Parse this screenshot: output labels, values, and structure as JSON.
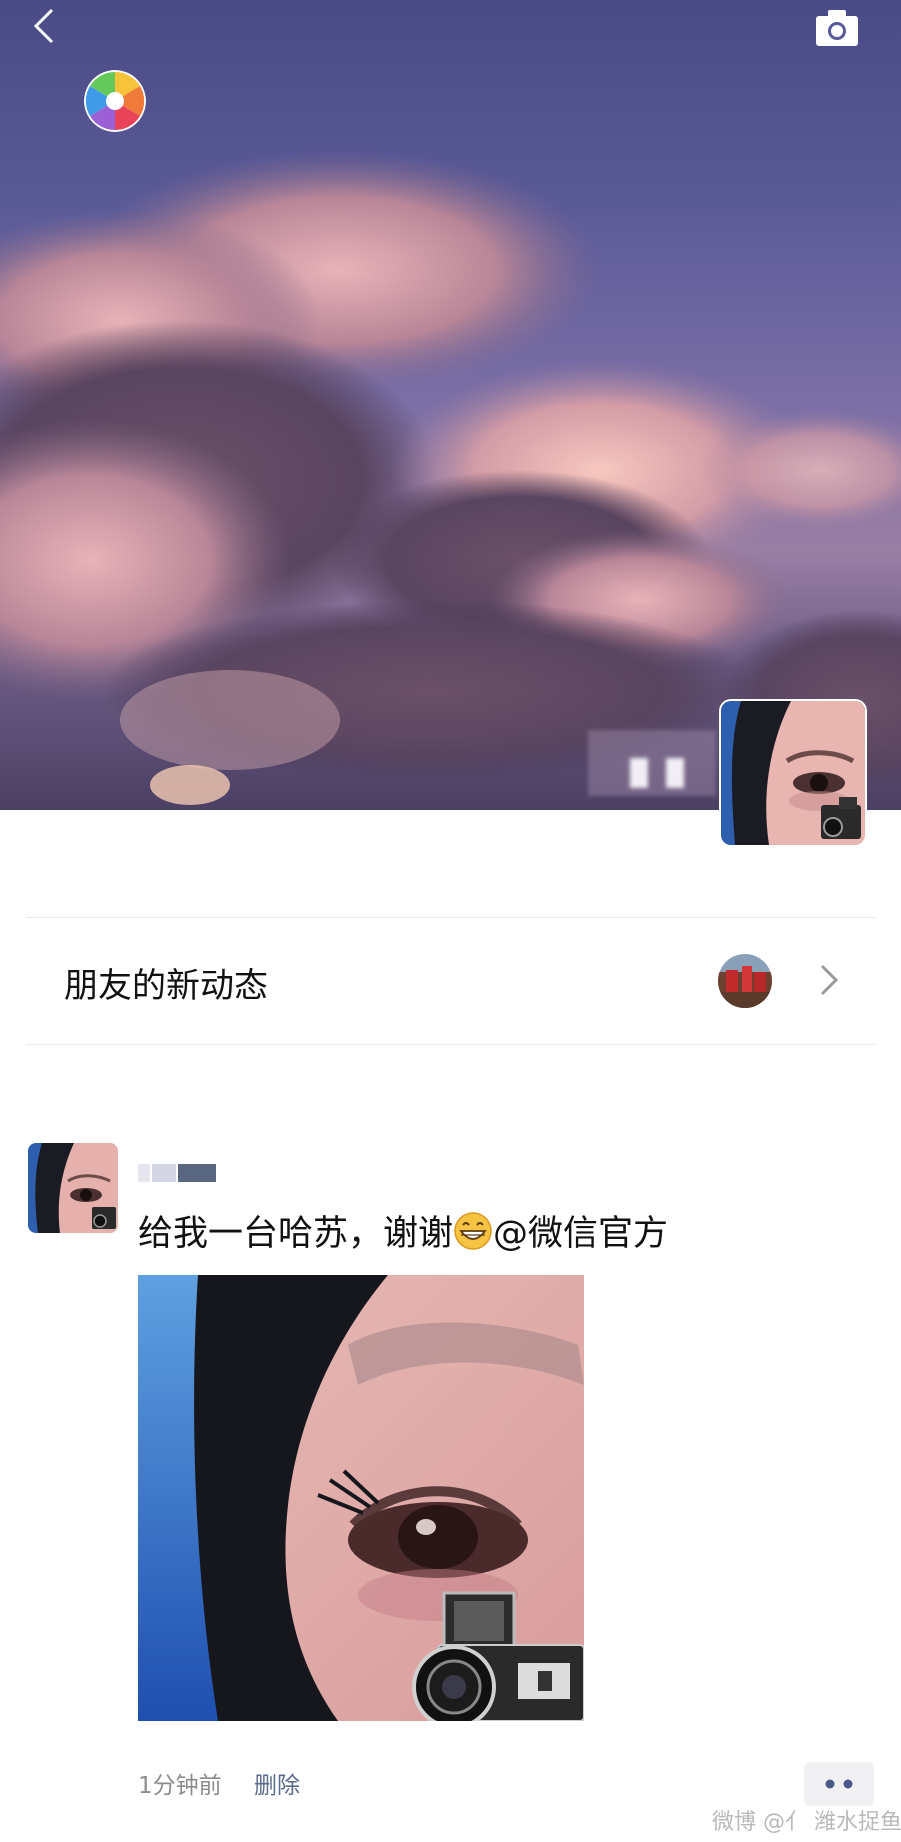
{
  "header": {
    "back_icon": "chevron-left-icon",
    "camera_icon": "camera-icon"
  },
  "friends_feed": {
    "label": "朋友的新动态",
    "chevron_icon": "chevron-right-icon"
  },
  "post": {
    "text_before": "给我一台哈苏，谢谢",
    "emoji": "grinning-face-emoji",
    "mention": "@微信官方",
    "time": "1分钟前",
    "delete_label": "删除",
    "more_icon": "more-dots-icon"
  },
  "watermark": "微博 @亻 潍水捉鱼",
  "colors": {
    "link": "#5a6a8c",
    "sky_top": "#4a4a86",
    "more_dots": "#4a5a88"
  }
}
